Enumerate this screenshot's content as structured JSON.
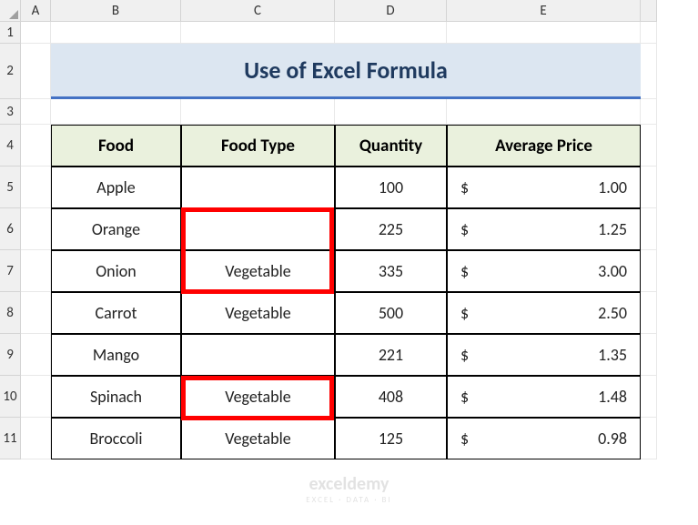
{
  "columns": [
    "A",
    "B",
    "C",
    "D",
    "E"
  ],
  "rows": [
    "1",
    "2",
    "3",
    "4",
    "5",
    "6",
    "7",
    "8",
    "9",
    "10",
    "11"
  ],
  "title": "Use of Excel Formula",
  "headers": {
    "food": "Food",
    "food_type": "Food Type",
    "quantity": "Quantity",
    "avg_price": "Average Price"
  },
  "data": [
    {
      "food": "Apple",
      "food_type": "",
      "quantity": "100",
      "currency": "$",
      "price": "1.00"
    },
    {
      "food": "Orange",
      "food_type": "",
      "quantity": "225",
      "currency": "$",
      "price": "1.25"
    },
    {
      "food": "Onion",
      "food_type": "Vegetable",
      "quantity": "335",
      "currency": "$",
      "price": "3.00"
    },
    {
      "food": "Carrot",
      "food_type": "Vegetable",
      "quantity": "500",
      "currency": "$",
      "price": "2.50"
    },
    {
      "food": "Mango",
      "food_type": "",
      "quantity": "221",
      "currency": "$",
      "price": "1.35"
    },
    {
      "food": "Spinach",
      "food_type": "Vegetable",
      "quantity": "408",
      "currency": "$",
      "price": "1.48"
    },
    {
      "food": "Broccoli",
      "food_type": "Vegetable",
      "quantity": "125",
      "currency": "$",
      "price": "0.98"
    }
  ],
  "watermark": {
    "main": "exceldemy",
    "sub": "EXCEL · DATA · BI"
  }
}
